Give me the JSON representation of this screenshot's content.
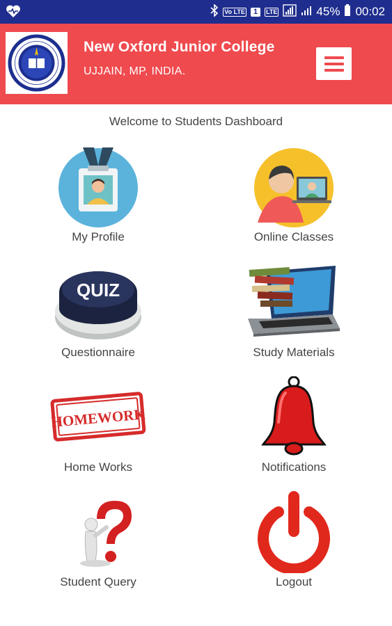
{
  "status_bar": {
    "battery_percent": "45%",
    "time": "00:02",
    "icons": [
      "heart-icon",
      "bluetooth-icon",
      "volte-icon",
      "sim-icon",
      "lte-icon",
      "signal-icon",
      "signal-2-icon",
      "battery-icon"
    ],
    "volte_tag": "Vo LTE",
    "lte_tag": "LTE",
    "sim_tag": "1"
  },
  "header": {
    "college_name": "New Oxford Junior College",
    "location": "UJJAIN, MP, INDIA.",
    "logo_text_top": "NEW OXFORD JUNIOR COLLEGE",
    "logo_text_bottom": "UJJAIN",
    "background_color": "#ef4a4e"
  },
  "welcome_text": "Welcome to Students Dashboard",
  "tiles": [
    {
      "label": "My Profile",
      "icon": "profile-badge-icon"
    },
    {
      "label": "Online Classes",
      "icon": "online-classes-icon"
    },
    {
      "label": "Questionnaire",
      "icon": "quiz-button-icon"
    },
    {
      "label": "Study Materials",
      "icon": "laptop-books-icon"
    },
    {
      "label": "Home Works",
      "icon": "homework-stamp-icon",
      "stamp_text": "HOMEWORK"
    },
    {
      "label": "Notifications",
      "icon": "bell-icon"
    },
    {
      "label": "Student Query",
      "icon": "question-mark-icon"
    },
    {
      "label": "Logout",
      "icon": "power-icon"
    }
  ],
  "quiz_text": "QUIZ",
  "colors": {
    "status_bar": "#1f2d8e",
    "accent_red": "#ef4a4e",
    "logout_red": "#e1281c"
  }
}
